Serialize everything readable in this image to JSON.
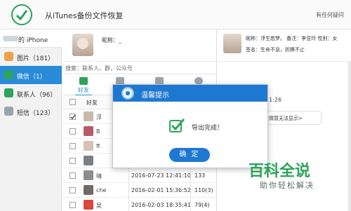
{
  "app": {
    "title": "从iTunes备份文件恢复",
    "top_right": "有任何疑问"
  },
  "device": {
    "name": "的 iPhone"
  },
  "sidebar": {
    "items": [
      {
        "label": "图片（181）",
        "icon": "photos-icon",
        "color": "#f0a04b"
      },
      {
        "label": "微信（1）",
        "icon": "wechat-icon",
        "color": "#2aa55a"
      },
      {
        "label": "联系人（96）",
        "icon": "contacts-icon",
        "color": "#2aa55a"
      },
      {
        "label": "短信（123）",
        "icon": "sms-icon",
        "color": "#9aa4ad"
      }
    ]
  },
  "profile": {
    "nickname_label": "昵称：_"
  },
  "search": {
    "placeholder": "搜索：联系人，群，公众号"
  },
  "tabs": [
    {
      "label": "好友"
    }
  ],
  "table": {
    "header_name": "好友",
    "rows": [
      {
        "name": "浮",
        "date": "",
        "count": "",
        "checked": true
      },
      {
        "name": "B",
        "date": "",
        "count": "",
        "checked": false
      },
      {
        "name": "ft",
        "date": "",
        "count": "",
        "checked": false
      },
      {
        "name": "",
        "date": "",
        "count": "",
        "checked": false
      },
      {
        "name": "晴",
        "date": "2016-07-23 12:41:10",
        "count": "133",
        "checked": false
      },
      {
        "name": "che",
        "date": "2016-02-01 15:36:52",
        "count": "110(3)",
        "checked": false
      },
      {
        "name": "吴",
        "date": "2016-02-03 18:35:41",
        "count": "79(4)",
        "checked": false
      }
    ]
  },
  "right": {
    "line1": "昵称：浮生若梦。  备注：李亚玲  性别：女",
    "line2": "签名：生命不息，折腾不止",
    "time": "11:26",
    "bubble": "[.表情暂无法显示>"
  },
  "modal": {
    "title": "温馨提示",
    "message": "导出完成！",
    "ok_label": "确 定"
  },
  "watermark": {
    "main": "百科全说",
    "sub": "助你轻松解决"
  },
  "colors": {
    "accent": "#1e78d2",
    "active_sidebar": "#2a8bd8",
    "brand_green": "#2aa55a"
  }
}
